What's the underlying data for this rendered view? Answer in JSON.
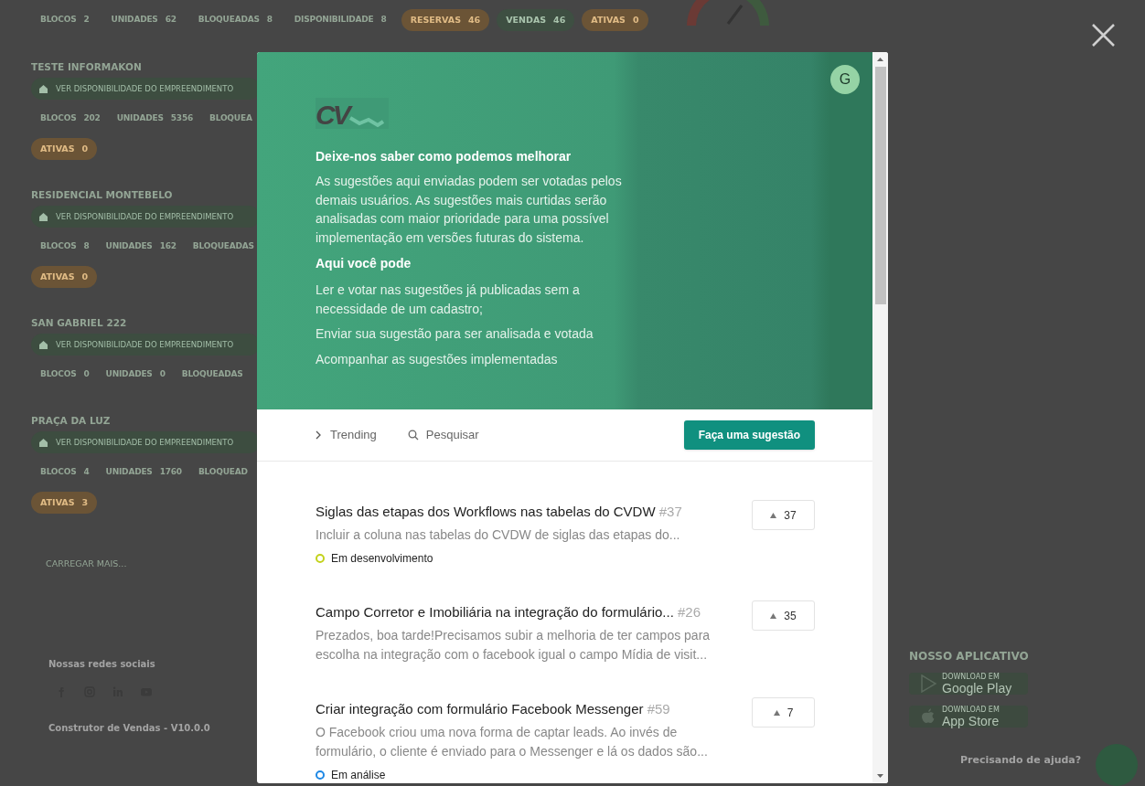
{
  "background": {
    "summary_stats": [
      {
        "kind": "stat",
        "label": "BLOCOS",
        "value": "2"
      },
      {
        "kind": "stat",
        "label": "UNIDADES",
        "value": "62"
      },
      {
        "kind": "stat",
        "label": "BLOQUEADAS",
        "value": "8"
      },
      {
        "kind": "stat",
        "label": "DISPONIBILIDADE",
        "value": "8"
      },
      {
        "kind": "pill",
        "label": "RESERVAS",
        "value": "46",
        "color": "#6b5436"
      },
      {
        "kind": "pill",
        "label": "VENDAS",
        "value": "46",
        "color": "#3e4f42"
      },
      {
        "kind": "pill",
        "label": "ATIVAS",
        "value": "0",
        "color": "#6b5436"
      }
    ],
    "projects": [
      {
        "name": "TESTE INFORMAKON",
        "button": "VER DISPONIBILIDADE DO EMPREENDIMENTO",
        "stats": [
          {
            "label": "BLOCOS",
            "value": "202"
          },
          {
            "label": "UNIDADES",
            "value": "5356"
          },
          {
            "label": "BLOQUEA"
          }
        ],
        "active": {
          "label": "ATIVAS",
          "value": "0"
        }
      },
      {
        "name": "RESIDENCIAL MONTEBELO",
        "button": "VER DISPONIBILIDADE DO EMPREENDIMENTO",
        "stats": [
          {
            "label": "BLOCOS",
            "value": "8"
          },
          {
            "label": "UNIDADES",
            "value": "162"
          },
          {
            "label": "BLOQUEADAS"
          }
        ],
        "active": {
          "label": "ATIVAS",
          "value": "0"
        }
      },
      {
        "name": "SAN GABRIEL 222",
        "button": "VER DISPONIBILIDADE DO EMPREENDIMENTO",
        "stats": [
          {
            "label": "BLOCOS",
            "value": "0"
          },
          {
            "label": "UNIDADES",
            "value": "0"
          },
          {
            "label": "BLOQUEADAS"
          }
        ]
      },
      {
        "name": "PRAÇA DA LUZ",
        "button": "VER DISPONIBILIDADE DO EMPREENDIMENTO",
        "stats": [
          {
            "label": "BLOCOS",
            "value": "4"
          },
          {
            "label": "UNIDADES",
            "value": "1760"
          },
          {
            "label": "BLOQUEAD"
          }
        ],
        "active": {
          "label": "ATIVAS",
          "value": "3"
        }
      }
    ],
    "load_more": "CARREGAR MAIS...",
    "social_title": "Nossas redes sociais",
    "version": "Construtor de Vendas - V10.0.0",
    "app": {
      "title": "NOSSO APLICATIVO",
      "stores": [
        {
          "kind": "google",
          "caption": "DOWNLOAD EM",
          "name": "Google Play"
        },
        {
          "kind": "apple",
          "caption": "DOWNLOAD EM",
          "name": "App Store"
        }
      ]
    },
    "help": "Precisando de ajuda?"
  },
  "modal": {
    "avatar": "G",
    "logo": "CV",
    "heading": "Deixe-nos saber como podemos melhorar",
    "intro": "As sugestões aqui enviadas podem ser votadas pelos demais usuários. As sugestões mais curtidas serão analisadas com maior prioridade para uma possível implementação em versões futuras do sistema.",
    "subheading": "Aqui você pode",
    "points": [
      "Ler e votar nas sugestões já publicadas sem a necessidade de um cadastro;",
      "Enviar sua sugestão para ser analisada e votada",
      "Acompanhar as sugestões implementadas"
    ],
    "toolbar": {
      "sort": "Trending",
      "search": {
        "placeholder": "Pesquisar"
      },
      "button": "Faça uma sugestão"
    },
    "suggestions": [
      {
        "title": "Siglas das etapas dos Workflows nas tabelas do CVDW",
        "number": "#37",
        "description": "Incluir a coluna nas tabelas do CVDW de siglas das etapas do...",
        "votes": "37",
        "status": {
          "label": "Em desenvolvimento",
          "color": "#c3d21b"
        }
      },
      {
        "title": "Campo Corretor e Imobiliária na integração do formulário...",
        "number": "#26",
        "description": "Prezados, boa tarde!Precisamos subir a melhoria de ter campos para escolha na integração com o facebook igual o campo Mídia de visit...",
        "votes": "35"
      },
      {
        "title": "Criar integração com formulário Facebook Messenger",
        "number": "#59",
        "description": "O Facebook criou uma nova forma de captar leads. Ao invés de formulário, o cliente é enviado para o Messenger e lá os dados são...",
        "votes": "7",
        "status": {
          "label": "Em análise",
          "color": "#1e88e5"
        }
      }
    ]
  }
}
